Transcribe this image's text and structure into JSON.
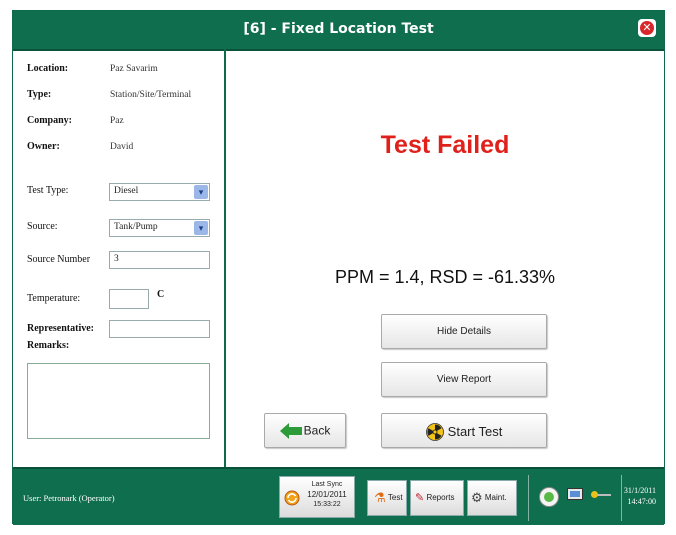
{
  "window": {
    "title": "[6] - Fixed Location Test"
  },
  "info": {
    "location_label": "Location:",
    "location_value": "Paz Savarim",
    "type_label": "Type:",
    "type_value": "Station/Site/Terminal",
    "company_label": "Company:",
    "company_value": "Paz",
    "owner_label": "Owner:",
    "owner_value": "David"
  },
  "form": {
    "test_type_label": "Test Type:",
    "test_type_value": "Diesel",
    "source_label": "Source:",
    "source_value": "Tank/Pump",
    "source_number_label": "Source Number",
    "source_number_value": "3",
    "temperature_label": "Temperature:",
    "temperature_value": "",
    "temperature_unit": "C",
    "representative_label": "Representative:",
    "representative_value": "",
    "remarks_label": "Remarks:",
    "remarks_value": ""
  },
  "main": {
    "status": "Test Failed",
    "result": "PPM = 1.4, RSD = -61.33%",
    "hide_details": "Hide Details",
    "view_report": "View Report",
    "back": "Back",
    "start_test": "Start Test"
  },
  "bottom": {
    "user": "User: Petronark (Operator)",
    "last_sync_label": "Last Sync",
    "last_sync_date": "12/01/2011",
    "last_sync_time": "15:33:22",
    "test": "Test",
    "reports": "Reports",
    "maint": "Maint.",
    "date": "31/1/2011",
    "time": "14:47:00"
  },
  "colors": {
    "brand_green": "#0f6e4d",
    "fail_red": "#e0201b"
  }
}
